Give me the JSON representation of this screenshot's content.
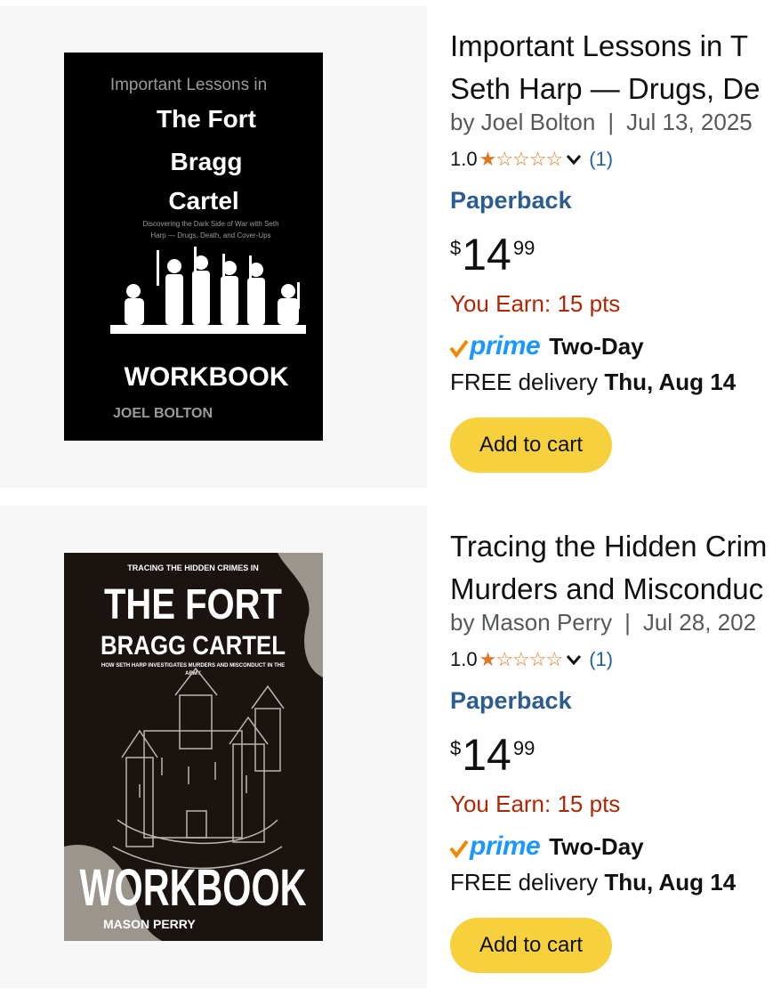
{
  "products": [
    {
      "title_lines": [
        "Important Lessons in T",
        "Seth Harp — Drugs, De"
      ],
      "author_text": "by Joel Bolton",
      "separator": "|",
      "date": "Jul 13, 2025",
      "rating": "1.0",
      "stars": "★☆☆☆☆",
      "review_count": "(1)",
      "format": "Paperback",
      "price": {
        "symbol": "$",
        "whole": "14",
        "fraction": "99"
      },
      "points": "You Earn: 15 pts",
      "prime": {
        "word": "prime",
        "speed": "Two-Day"
      },
      "delivery_prefix": "FREE delivery",
      "delivery_date": "Thu, Aug 14",
      "cart_label": "Add to cart",
      "cover": {
        "top_line": "Important Lessons in",
        "title_lines": [
          "The Fort",
          "Bragg",
          "Cartel"
        ],
        "subtitle_lines": [
          "Discovering the Dark Side of War with Seth",
          "Harp — Drugs, Death, and Cover-Ups"
        ],
        "workbook": "WORKBOOK",
        "author": "JOEL BOLTON"
      }
    },
    {
      "title_lines": [
        "Tracing the Hidden Crim",
        "Murders and Misconduc"
      ],
      "author_text": "by Mason Perry",
      "separator": "|",
      "date": "Jul 28, 202",
      "rating": "1.0",
      "stars": "★☆☆☆☆",
      "review_count": "(1)",
      "format": "Paperback",
      "price": {
        "symbol": "$",
        "whole": "14",
        "fraction": "99"
      },
      "points": "You Earn: 15 pts",
      "prime": {
        "word": "prime",
        "speed": "Two-Day"
      },
      "delivery_prefix": "FREE delivery",
      "delivery_date": "Thu, Aug 14",
      "cart_label": "Add to cart",
      "cover": {
        "top_line": "TRACING THE HIDDEN CRIMES IN",
        "title_lines": [
          "THE FORT",
          "BRAGG CARTEL"
        ],
        "subtitle_lines": [
          "HOW SETH HARP INVESTIGATES MURDERS AND MISCONDUCT IN THE",
          "ARMY"
        ],
        "workbook": "WORKBOOK",
        "author": "MASON PERRY"
      }
    }
  ],
  "colors": {
    "star": "#de7921",
    "link": "#2162a1",
    "format": "#2d5c8e",
    "points": "#b12704",
    "prime": "#1a98ff",
    "cart_button": "#f7d13d",
    "image_bg": "#f7f7f7"
  }
}
